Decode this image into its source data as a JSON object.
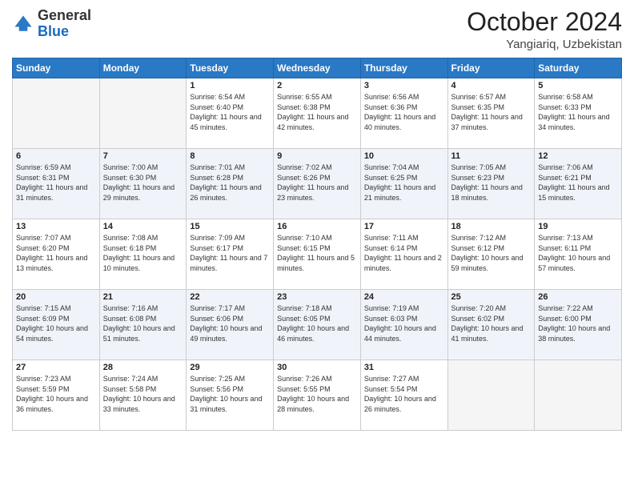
{
  "logo": {
    "general": "General",
    "blue": "Blue"
  },
  "title": {
    "month": "October 2024",
    "location": "Yangiariq, Uzbekistan"
  },
  "weekdays": [
    "Sunday",
    "Monday",
    "Tuesday",
    "Wednesday",
    "Thursday",
    "Friday",
    "Saturday"
  ],
  "weeks": [
    [
      {
        "day": "",
        "sunrise": "",
        "sunset": "",
        "daylight": "",
        "empty": true
      },
      {
        "day": "",
        "sunrise": "",
        "sunset": "",
        "daylight": "",
        "empty": true
      },
      {
        "day": "1",
        "sunrise": "Sunrise: 6:54 AM",
        "sunset": "Sunset: 6:40 PM",
        "daylight": "Daylight: 11 hours and 45 minutes.",
        "empty": false
      },
      {
        "day": "2",
        "sunrise": "Sunrise: 6:55 AM",
        "sunset": "Sunset: 6:38 PM",
        "daylight": "Daylight: 11 hours and 42 minutes.",
        "empty": false
      },
      {
        "day": "3",
        "sunrise": "Sunrise: 6:56 AM",
        "sunset": "Sunset: 6:36 PM",
        "daylight": "Daylight: 11 hours and 40 minutes.",
        "empty": false
      },
      {
        "day": "4",
        "sunrise": "Sunrise: 6:57 AM",
        "sunset": "Sunset: 6:35 PM",
        "daylight": "Daylight: 11 hours and 37 minutes.",
        "empty": false
      },
      {
        "day": "5",
        "sunrise": "Sunrise: 6:58 AM",
        "sunset": "Sunset: 6:33 PM",
        "daylight": "Daylight: 11 hours and 34 minutes.",
        "empty": false
      }
    ],
    [
      {
        "day": "6",
        "sunrise": "Sunrise: 6:59 AM",
        "sunset": "Sunset: 6:31 PM",
        "daylight": "Daylight: 11 hours and 31 minutes.",
        "empty": false
      },
      {
        "day": "7",
        "sunrise": "Sunrise: 7:00 AM",
        "sunset": "Sunset: 6:30 PM",
        "daylight": "Daylight: 11 hours and 29 minutes.",
        "empty": false
      },
      {
        "day": "8",
        "sunrise": "Sunrise: 7:01 AM",
        "sunset": "Sunset: 6:28 PM",
        "daylight": "Daylight: 11 hours and 26 minutes.",
        "empty": false
      },
      {
        "day": "9",
        "sunrise": "Sunrise: 7:02 AM",
        "sunset": "Sunset: 6:26 PM",
        "daylight": "Daylight: 11 hours and 23 minutes.",
        "empty": false
      },
      {
        "day": "10",
        "sunrise": "Sunrise: 7:04 AM",
        "sunset": "Sunset: 6:25 PM",
        "daylight": "Daylight: 11 hours and 21 minutes.",
        "empty": false
      },
      {
        "day": "11",
        "sunrise": "Sunrise: 7:05 AM",
        "sunset": "Sunset: 6:23 PM",
        "daylight": "Daylight: 11 hours and 18 minutes.",
        "empty": false
      },
      {
        "day": "12",
        "sunrise": "Sunrise: 7:06 AM",
        "sunset": "Sunset: 6:21 PM",
        "daylight": "Daylight: 11 hours and 15 minutes.",
        "empty": false
      }
    ],
    [
      {
        "day": "13",
        "sunrise": "Sunrise: 7:07 AM",
        "sunset": "Sunset: 6:20 PM",
        "daylight": "Daylight: 11 hours and 13 minutes.",
        "empty": false
      },
      {
        "day": "14",
        "sunrise": "Sunrise: 7:08 AM",
        "sunset": "Sunset: 6:18 PM",
        "daylight": "Daylight: 11 hours and 10 minutes.",
        "empty": false
      },
      {
        "day": "15",
        "sunrise": "Sunrise: 7:09 AM",
        "sunset": "Sunset: 6:17 PM",
        "daylight": "Daylight: 11 hours and 7 minutes.",
        "empty": false
      },
      {
        "day": "16",
        "sunrise": "Sunrise: 7:10 AM",
        "sunset": "Sunset: 6:15 PM",
        "daylight": "Daylight: 11 hours and 5 minutes.",
        "empty": false
      },
      {
        "day": "17",
        "sunrise": "Sunrise: 7:11 AM",
        "sunset": "Sunset: 6:14 PM",
        "daylight": "Daylight: 11 hours and 2 minutes.",
        "empty": false
      },
      {
        "day": "18",
        "sunrise": "Sunrise: 7:12 AM",
        "sunset": "Sunset: 6:12 PM",
        "daylight": "Daylight: 10 hours and 59 minutes.",
        "empty": false
      },
      {
        "day": "19",
        "sunrise": "Sunrise: 7:13 AM",
        "sunset": "Sunset: 6:11 PM",
        "daylight": "Daylight: 10 hours and 57 minutes.",
        "empty": false
      }
    ],
    [
      {
        "day": "20",
        "sunrise": "Sunrise: 7:15 AM",
        "sunset": "Sunset: 6:09 PM",
        "daylight": "Daylight: 10 hours and 54 minutes.",
        "empty": false
      },
      {
        "day": "21",
        "sunrise": "Sunrise: 7:16 AM",
        "sunset": "Sunset: 6:08 PM",
        "daylight": "Daylight: 10 hours and 51 minutes.",
        "empty": false
      },
      {
        "day": "22",
        "sunrise": "Sunrise: 7:17 AM",
        "sunset": "Sunset: 6:06 PM",
        "daylight": "Daylight: 10 hours and 49 minutes.",
        "empty": false
      },
      {
        "day": "23",
        "sunrise": "Sunrise: 7:18 AM",
        "sunset": "Sunset: 6:05 PM",
        "daylight": "Daylight: 10 hours and 46 minutes.",
        "empty": false
      },
      {
        "day": "24",
        "sunrise": "Sunrise: 7:19 AM",
        "sunset": "Sunset: 6:03 PM",
        "daylight": "Daylight: 10 hours and 44 minutes.",
        "empty": false
      },
      {
        "day": "25",
        "sunrise": "Sunrise: 7:20 AM",
        "sunset": "Sunset: 6:02 PM",
        "daylight": "Daylight: 10 hours and 41 minutes.",
        "empty": false
      },
      {
        "day": "26",
        "sunrise": "Sunrise: 7:22 AM",
        "sunset": "Sunset: 6:00 PM",
        "daylight": "Daylight: 10 hours and 38 minutes.",
        "empty": false
      }
    ],
    [
      {
        "day": "27",
        "sunrise": "Sunrise: 7:23 AM",
        "sunset": "Sunset: 5:59 PM",
        "daylight": "Daylight: 10 hours and 36 minutes.",
        "empty": false
      },
      {
        "day": "28",
        "sunrise": "Sunrise: 7:24 AM",
        "sunset": "Sunset: 5:58 PM",
        "daylight": "Daylight: 10 hours and 33 minutes.",
        "empty": false
      },
      {
        "day": "29",
        "sunrise": "Sunrise: 7:25 AM",
        "sunset": "Sunset: 5:56 PM",
        "daylight": "Daylight: 10 hours and 31 minutes.",
        "empty": false
      },
      {
        "day": "30",
        "sunrise": "Sunrise: 7:26 AM",
        "sunset": "Sunset: 5:55 PM",
        "daylight": "Daylight: 10 hours and 28 minutes.",
        "empty": false
      },
      {
        "day": "31",
        "sunrise": "Sunrise: 7:27 AM",
        "sunset": "Sunset: 5:54 PM",
        "daylight": "Daylight: 10 hours and 26 minutes.",
        "empty": false
      },
      {
        "day": "",
        "sunrise": "",
        "sunset": "",
        "daylight": "",
        "empty": true
      },
      {
        "day": "",
        "sunrise": "",
        "sunset": "",
        "daylight": "",
        "empty": true
      }
    ]
  ]
}
